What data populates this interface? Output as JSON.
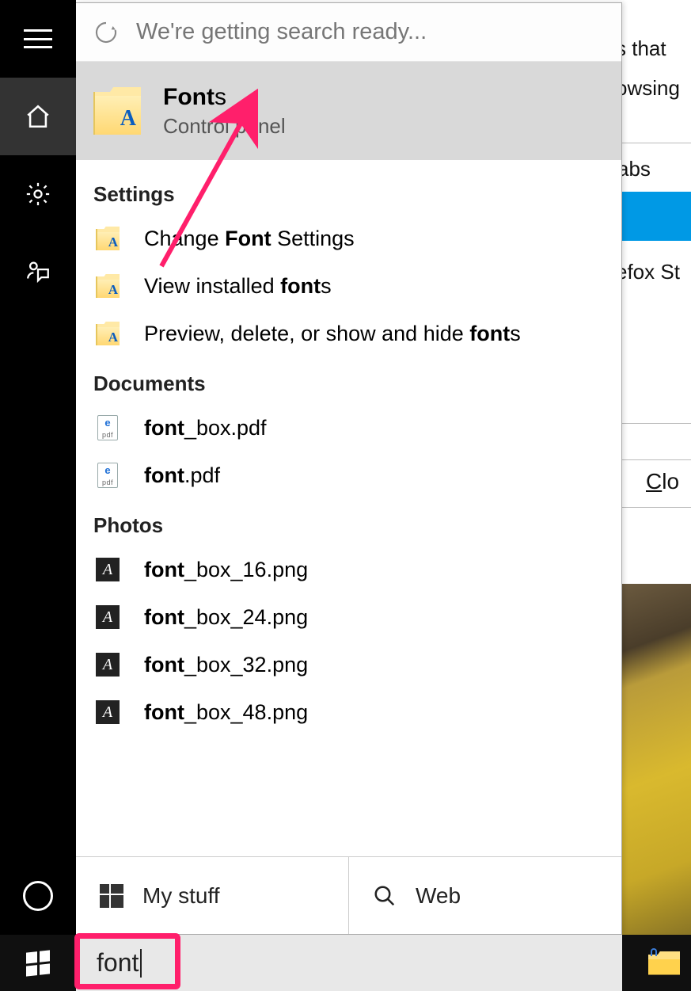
{
  "rail": {
    "buttons": [
      "menu",
      "home",
      "settings",
      "feedback",
      "cortana"
    ]
  },
  "header": {
    "status_text": "We're getting search ready..."
  },
  "best_match": {
    "title_bold": "Font",
    "title_rest": "s",
    "subtitle": "Control panel"
  },
  "sections": [
    {
      "label": "Settings",
      "items": [
        {
          "icon": "folder-font",
          "parts": [
            "Change ",
            "Font",
            " Settings"
          ],
          "bold": [
            1
          ]
        },
        {
          "icon": "folder-font",
          "parts": [
            "View installed ",
            "font",
            "s"
          ],
          "bold": [
            1
          ]
        },
        {
          "icon": "folder-font",
          "parts": [
            "Preview, delete, or show and hide ",
            "font",
            "s"
          ],
          "bold": [
            1
          ]
        }
      ]
    },
    {
      "label": "Documents",
      "items": [
        {
          "icon": "pdf",
          "parts": [
            "font",
            "_box.pdf"
          ],
          "bold": [
            0
          ]
        },
        {
          "icon": "pdf",
          "parts": [
            "font",
            ".pdf"
          ],
          "bold": [
            0
          ]
        }
      ]
    },
    {
      "label": "Photos",
      "items": [
        {
          "icon": "png",
          "parts": [
            "font",
            "_box_16.png"
          ],
          "bold": [
            0
          ]
        },
        {
          "icon": "png",
          "parts": [
            "font",
            "_box_24.png"
          ],
          "bold": [
            0
          ]
        },
        {
          "icon": "png",
          "parts": [
            "font",
            "_box_32.png"
          ],
          "bold": [
            0
          ]
        },
        {
          "icon": "png",
          "parts": [
            "font",
            "_box_48.png"
          ],
          "bold": [
            0
          ]
        }
      ]
    }
  ],
  "actions": {
    "my_stuff": "My stuff",
    "web": "Web"
  },
  "search": {
    "value": "font"
  },
  "background": {
    "frag1": "s that",
    "frag2": "owsing",
    "frag3": "abs",
    "frag4": "efox St",
    "close_u": "C",
    "close_rest": "lo"
  }
}
